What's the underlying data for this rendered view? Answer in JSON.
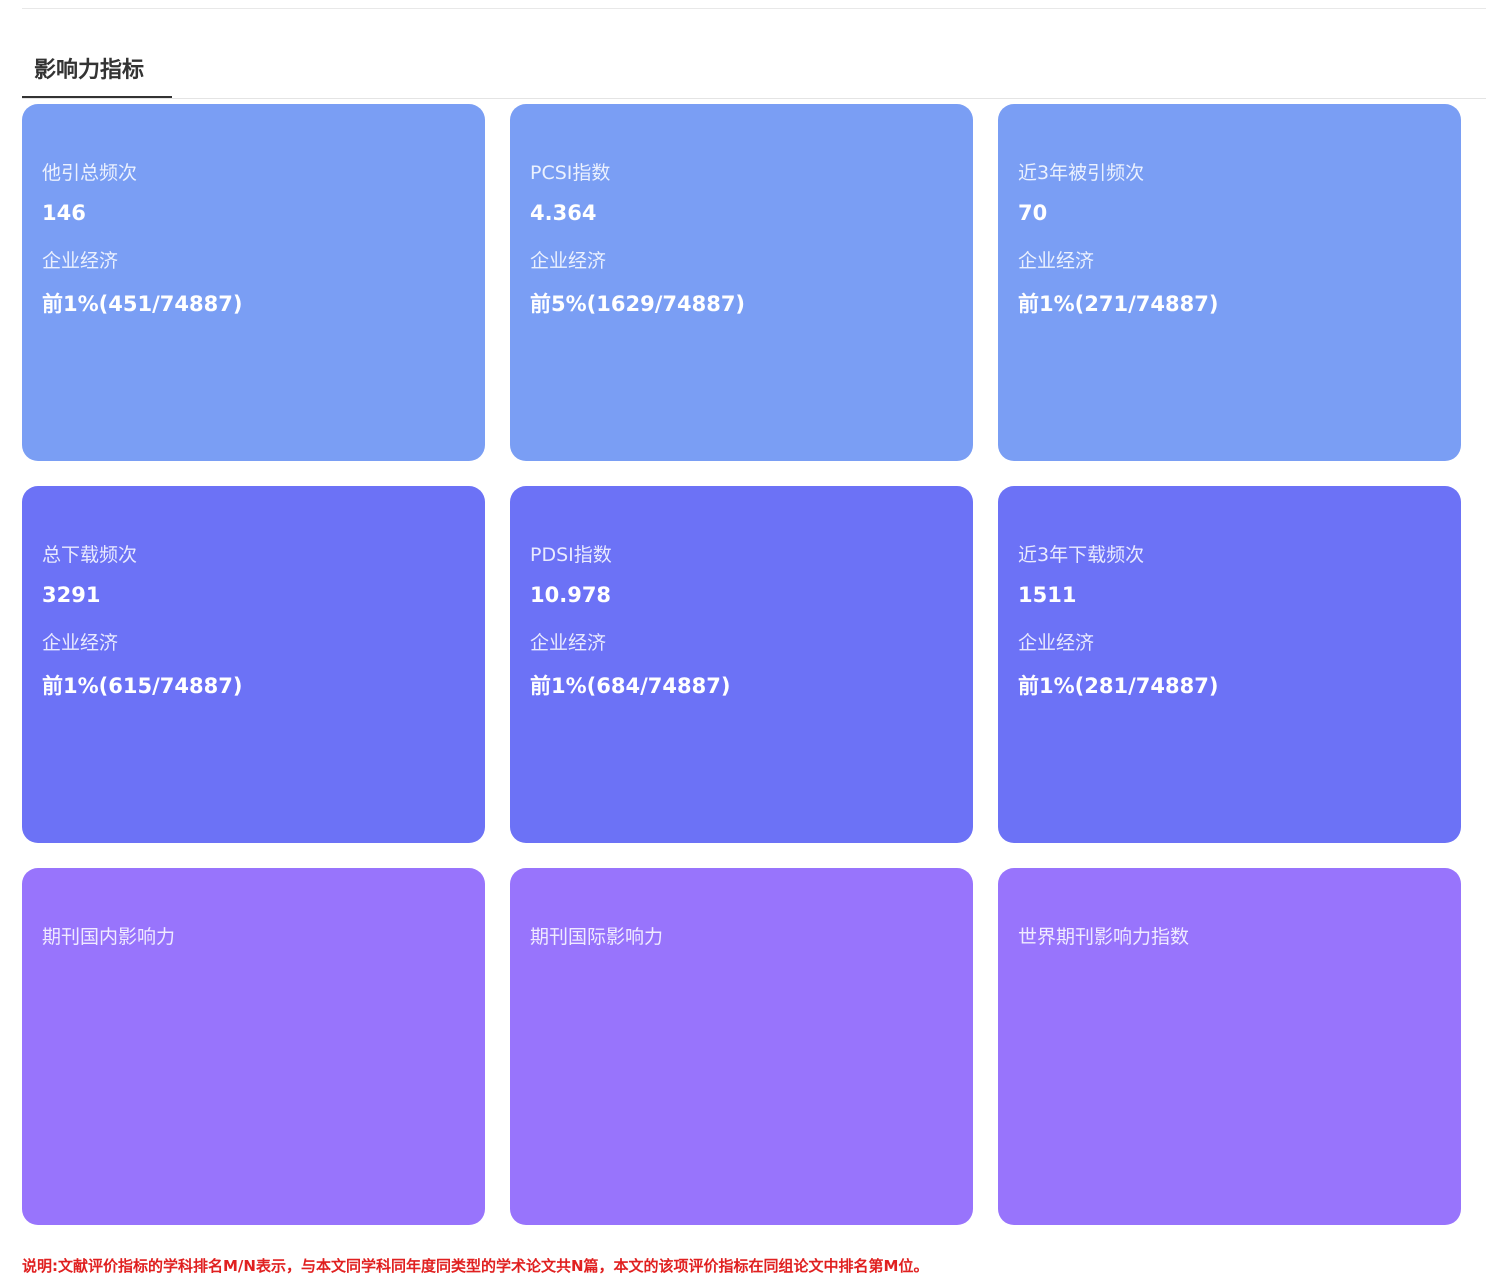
{
  "section": {
    "tab_label": "影响力指标"
  },
  "cards": [
    {
      "label": "他引总频次",
      "value": "146",
      "subject": "企业经济",
      "rank": "前1%(451/74887)"
    },
    {
      "label": "PCSI指数",
      "value": "4.364",
      "subject": "企业经济",
      "rank": "前5%(1629/74887)"
    },
    {
      "label": "近3年被引频次",
      "value": "70",
      "subject": "企业经济",
      "rank": "前1%(271/74887)"
    },
    {
      "label": "总下载频次",
      "value": "3291",
      "subject": "企业经济",
      "rank": "前1%(615/74887)"
    },
    {
      "label": "PDSI指数",
      "value": "10.978",
      "subject": "企业经济",
      "rank": "前1%(684/74887)"
    },
    {
      "label": "近3年下载频次",
      "value": "1511",
      "subject": "企业经济",
      "rank": "前1%(281/74887)"
    },
    {
      "label": "期刊国内影响力"
    },
    {
      "label": "期刊国际影响力"
    },
    {
      "label": "世界期刊影响力指数"
    }
  ],
  "colors": {
    "row1": "#7a9ef4",
    "row2": "#6c72f6",
    "row3": "#9874fc",
    "note": "#e02020"
  },
  "footnote": "说明:文献评价指标的学科排名M/N表示，与本文同学科同年度同类型的学术论文共N篇，本文的该项评价指标在同组论文中排名第M位。"
}
